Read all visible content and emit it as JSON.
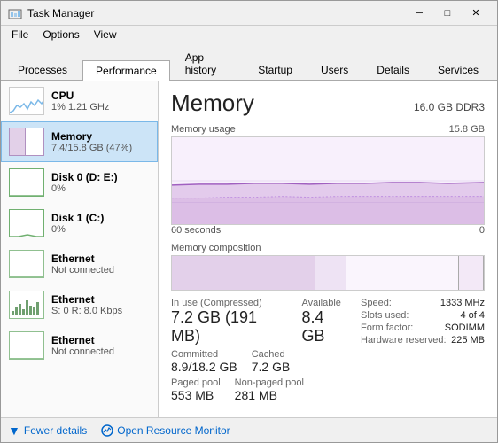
{
  "window": {
    "title": "Task Manager",
    "minimize_label": "─",
    "maximize_label": "□",
    "close_label": "✕"
  },
  "menu": {
    "items": [
      "File",
      "Options",
      "View"
    ]
  },
  "tabs": [
    {
      "label": "Processes",
      "active": false
    },
    {
      "label": "Performance",
      "active": true
    },
    {
      "label": "App history",
      "active": false
    },
    {
      "label": "Startup",
      "active": false
    },
    {
      "label": "Users",
      "active": false
    },
    {
      "label": "Details",
      "active": false
    },
    {
      "label": "Services",
      "active": false
    }
  ],
  "sidebar": {
    "items": [
      {
        "id": "cpu",
        "label": "CPU",
        "sub": "1% 1.21 GHz",
        "active": false
      },
      {
        "id": "memory",
        "label": "Memory",
        "sub": "7.4/15.8 GB (47%)",
        "active": true
      },
      {
        "id": "disk0",
        "label": "Disk 0 (D: E:)",
        "sub": "0%",
        "active": false
      },
      {
        "id": "disk1",
        "label": "Disk 1 (C:)",
        "sub": "0%",
        "active": false
      },
      {
        "id": "eth1",
        "label": "Ethernet",
        "sub": "Not connected",
        "active": false
      },
      {
        "id": "eth2",
        "label": "Ethernet",
        "sub": "S: 0 R: 8.0 Kbps",
        "active": false
      },
      {
        "id": "eth3",
        "label": "Ethernet",
        "sub": "Not connected",
        "active": false
      }
    ]
  },
  "panel": {
    "title": "Memory",
    "spec": "16.0 GB DDR3",
    "charts": {
      "usage_label": "Memory usage",
      "usage_max": "15.8 GB",
      "usage_time": "60 seconds",
      "usage_time_right": "0",
      "composition_label": "Memory composition"
    },
    "stats": {
      "in_use_label": "In use (Compressed)",
      "in_use_value": "7.2 GB (191 MB)",
      "available_label": "Available",
      "available_value": "8.4 GB",
      "committed_label": "Committed",
      "committed_value": "8.9/18.2 GB",
      "cached_label": "Cached",
      "cached_value": "7.2 GB",
      "paged_pool_label": "Paged pool",
      "paged_pool_value": "553 MB",
      "non_paged_pool_label": "Non-paged pool",
      "non_paged_pool_value": "281 MB",
      "speed_label": "Speed:",
      "speed_value": "1333 MHz",
      "slots_label": "Slots used:",
      "slots_value": "4 of 4",
      "form_label": "Form factor:",
      "form_value": "SODIMM",
      "hw_reserved_label": "Hardware reserved:",
      "hw_reserved_value": "225 MB"
    }
  },
  "bottom": {
    "fewer_details_label": "Fewer details",
    "open_monitor_label": "Open Resource Monitor"
  }
}
